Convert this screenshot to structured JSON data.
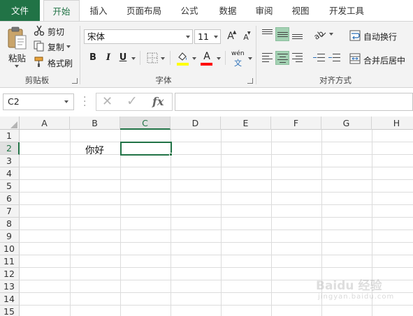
{
  "tabs": [
    "文件",
    "开始",
    "插入",
    "页面布局",
    "公式",
    "数据",
    "审阅",
    "视图",
    "开发工具"
  ],
  "clipboard": {
    "paste_label": "粘贴",
    "cut_label": "剪切",
    "copy_label": "复制",
    "format_painter_label": "格式刷",
    "group_label": "剪贴板"
  },
  "font": {
    "font_name": "宋体",
    "font_size": "11",
    "bold": "B",
    "italic": "I",
    "underline": "U",
    "grow": "A",
    "shrink": "A",
    "font_color": "A",
    "phonetic_top": "wén",
    "phonetic_bottom": "文",
    "group_label": "字体",
    "fill_color": "#ffff00",
    "text_color": "#ff0000"
  },
  "alignment": {
    "wrap_text_label": "自动换行",
    "merge_center_label": "合并后居中",
    "group_label": "对齐方式"
  },
  "formula_bar": {
    "name_box": "C2",
    "cancel_icon": "✕",
    "enter_icon": "✓",
    "fx_label": "fx",
    "formula_value": ""
  },
  "sheet": {
    "columns": [
      "A",
      "B",
      "C",
      "D",
      "E",
      "F",
      "G",
      "H"
    ],
    "rows": [
      "1",
      "2",
      "3",
      "4",
      "5",
      "6",
      "7",
      "8",
      "9",
      "10",
      "11",
      "12",
      "13",
      "14",
      "15"
    ],
    "active_column": "C",
    "active_row": "2",
    "cell_b2": "你好"
  },
  "watermark": {
    "text": "Baidu 经验",
    "sub": "jingyan.baidu.com"
  },
  "colors": {
    "accent": "#217346",
    "ribbon_bg": "#f3f3f3",
    "align_on": "#a3d1b3"
  }
}
